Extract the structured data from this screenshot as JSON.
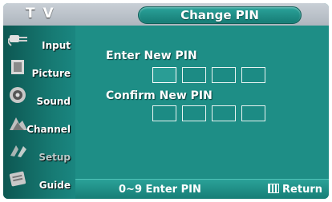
{
  "header": {
    "tv_label": "T V",
    "title": "Change PIN"
  },
  "sidebar": {
    "items": [
      {
        "label": "Input",
        "icon": "input-plug-icon",
        "enabled": true
      },
      {
        "label": "Picture",
        "icon": "picture-icon",
        "enabled": true
      },
      {
        "label": "Sound",
        "icon": "speaker-icon",
        "enabled": true
      },
      {
        "label": "Channel",
        "icon": "satellite-dish-icon",
        "enabled": true
      },
      {
        "label": "Setup",
        "icon": "setup-icon",
        "enabled": false
      },
      {
        "label": "Guide",
        "icon": "guide-icon",
        "enabled": true
      }
    ]
  },
  "main": {
    "enter_label": "Enter New PIN",
    "confirm_label": "Confirm New PIN",
    "pin_digits": 4
  },
  "footer": {
    "hint": "0~9 Enter PIN",
    "return_label": "Return"
  },
  "colors": {
    "background": "#1e8e86",
    "topbar": "#aeb6be",
    "accent": "#167c75"
  }
}
